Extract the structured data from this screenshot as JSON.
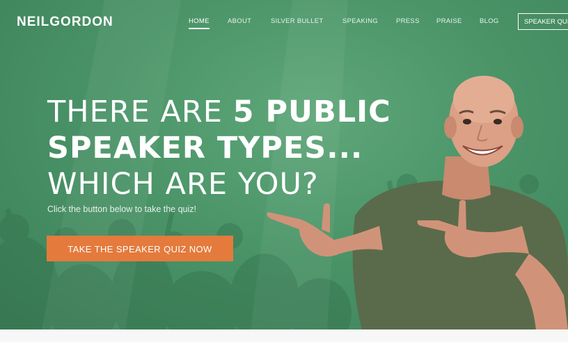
{
  "header": {
    "logo": "NEILGORDON",
    "nav": [
      {
        "label": "HOME",
        "active": true
      },
      {
        "label": "ABOUT"
      },
      {
        "label": "SILVER BULLET"
      },
      {
        "label": "SPEAKING"
      },
      {
        "label": "PRESS"
      },
      {
        "label": "PRAISE"
      },
      {
        "label": "BLOG"
      }
    ],
    "cta_label": "SPEAKER QUIZ"
  },
  "hero": {
    "headline": {
      "line1_light": "THERE ARE ",
      "line1_bold": "5 PUBLIC",
      "line2_bold": "SPEAKER TYPES...",
      "line3_light": "WHICH ARE YOU?"
    },
    "subtext": "Click the button below to take the quiz!",
    "button_label": "TAKE THE SPEAKER QUIZ NOW"
  },
  "colors": {
    "background_green": "#4a9468",
    "button_orange": "#e47a3c",
    "text_white": "#ffffff"
  }
}
